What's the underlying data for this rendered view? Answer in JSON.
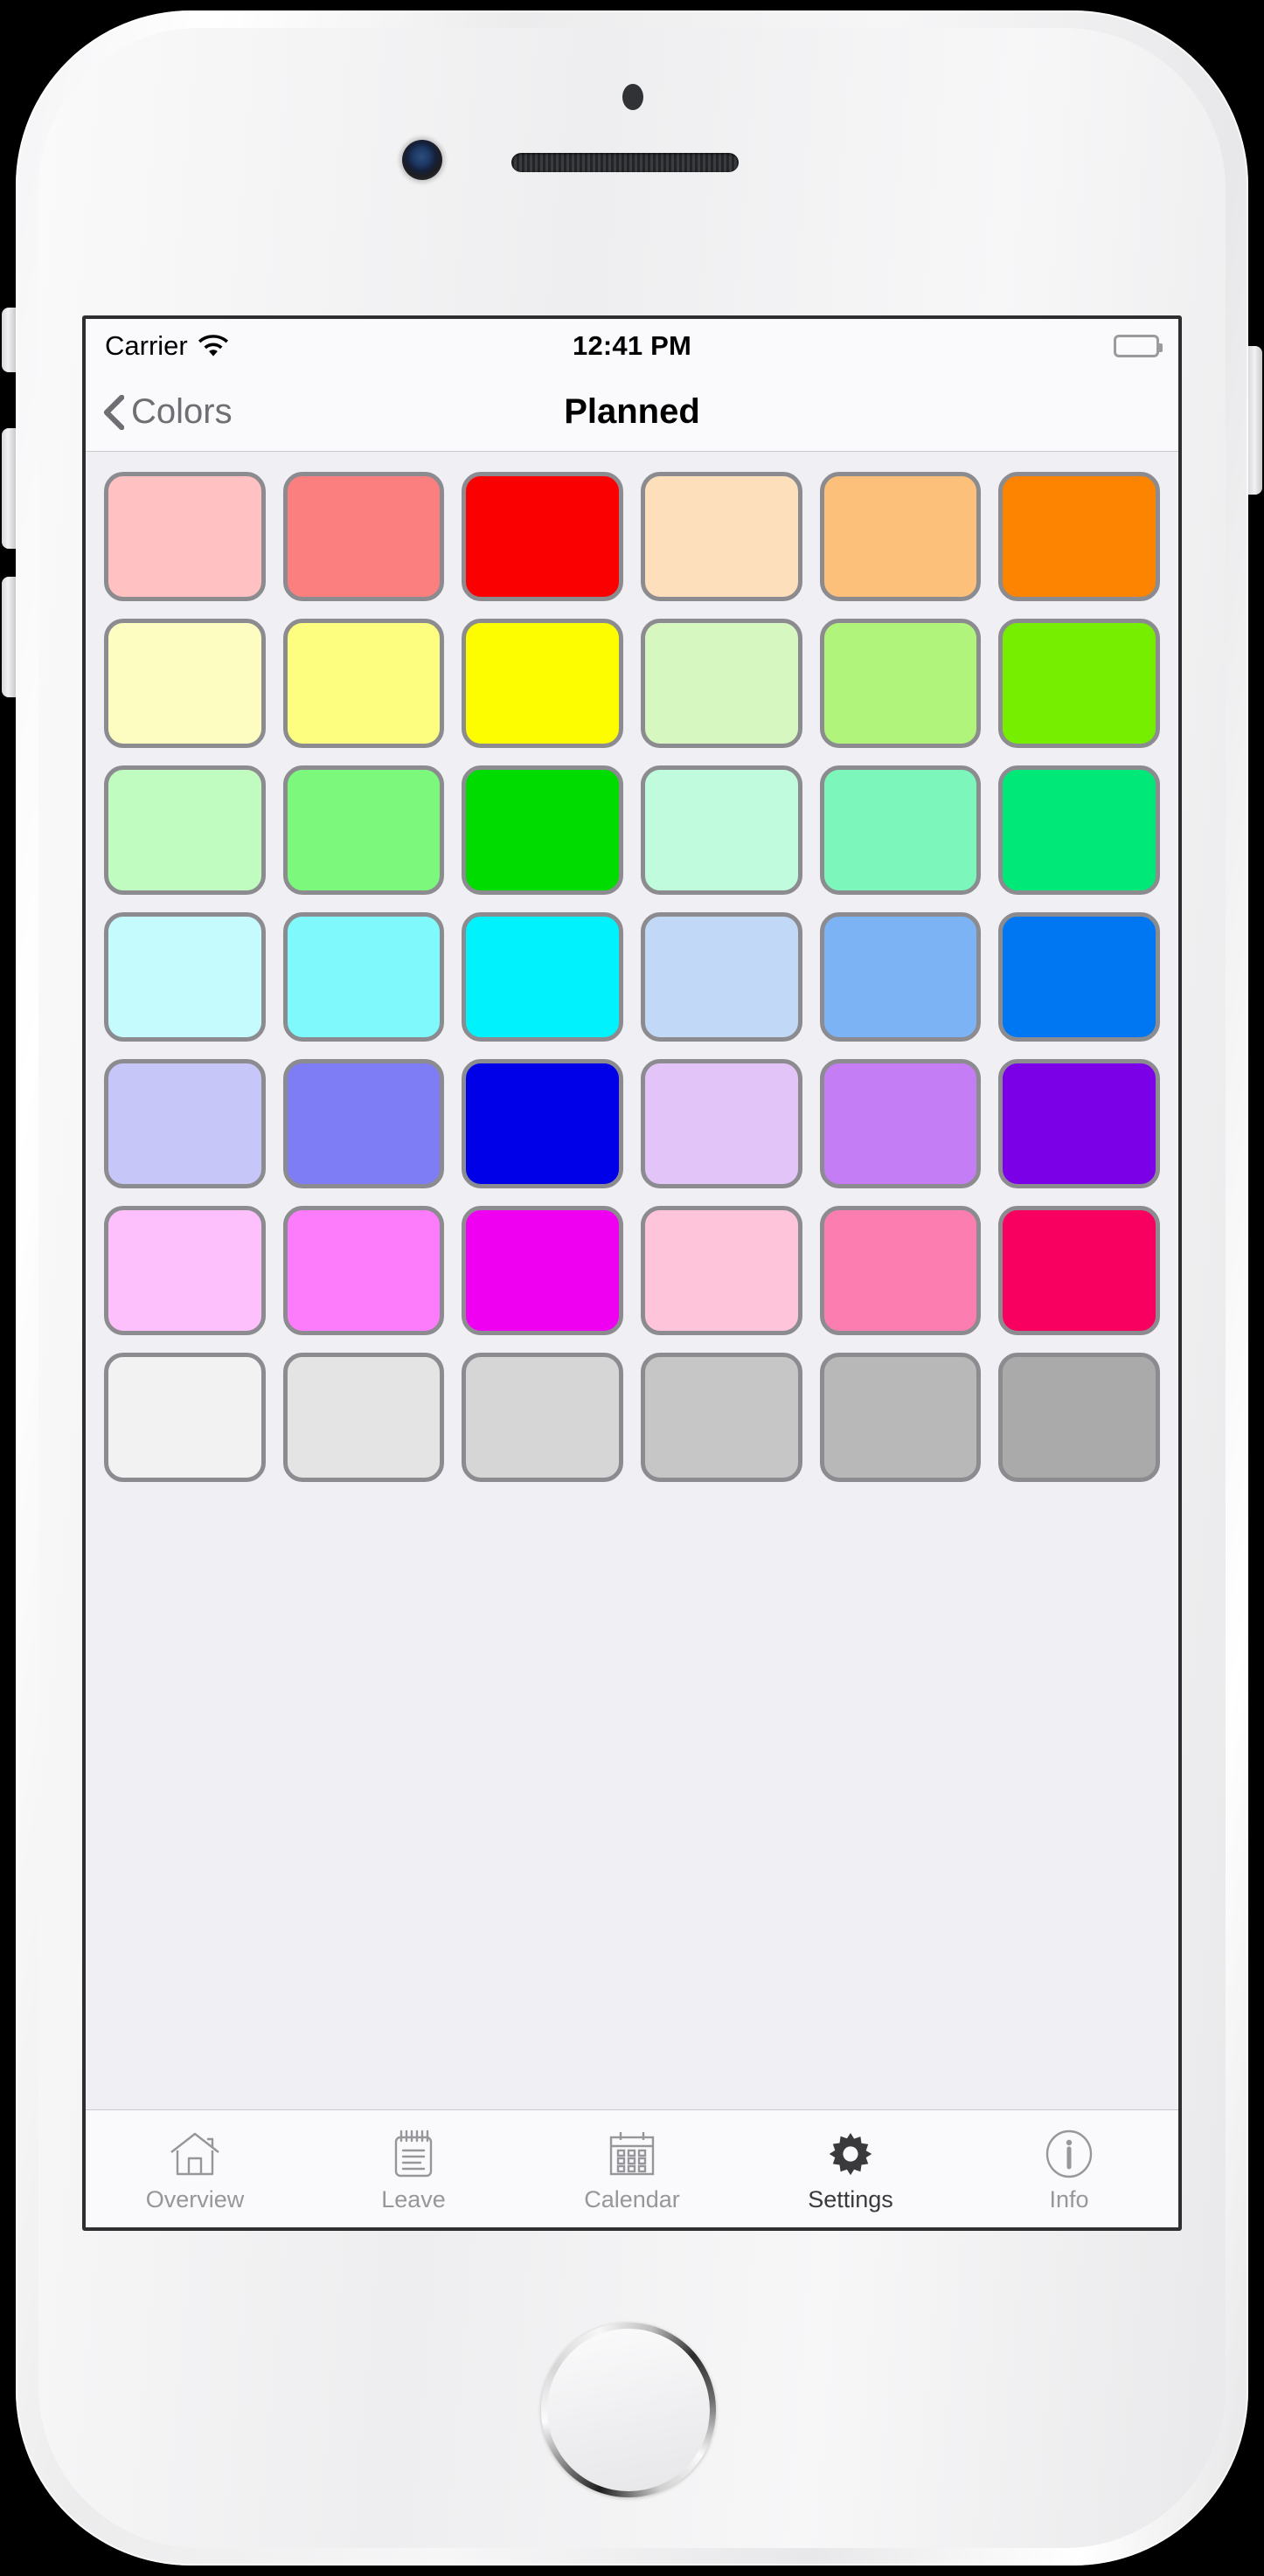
{
  "status_bar": {
    "carrier": "Carrier",
    "wifi_icon": "wifi-icon",
    "time": "12:41 PM",
    "battery_icon": "battery-full-icon"
  },
  "nav_bar": {
    "back_icon": "chevron-left-icon",
    "back_label": "Colors",
    "title": "Planned"
  },
  "color_grid": {
    "columns": 6,
    "rows": 7,
    "border_color": "#8c8c90",
    "background": "#f0f0f4",
    "swatches": [
      {
        "name": "light-pink",
        "hex": "#FFC1C1"
      },
      {
        "name": "salmon",
        "hex": "#FC7F7F"
      },
      {
        "name": "red",
        "hex": "#FB0000"
      },
      {
        "name": "peach",
        "hex": "#FDDFBB"
      },
      {
        "name": "light-orange",
        "hex": "#FCC07A"
      },
      {
        "name": "orange",
        "hex": "#FC8400"
      },
      {
        "name": "pale-yellow",
        "hex": "#FDFDC1"
      },
      {
        "name": "light-yellow",
        "hex": "#FDFD7F"
      },
      {
        "name": "yellow",
        "hex": "#FDFD00"
      },
      {
        "name": "pale-yellow-green",
        "hex": "#D7F7C0"
      },
      {
        "name": "light-yellow-green",
        "hex": "#B0F47C"
      },
      {
        "name": "chartreuse",
        "hex": "#76EE00"
      },
      {
        "name": "pale-green",
        "hex": "#C0FBC0"
      },
      {
        "name": "light-green",
        "hex": "#7CF97C"
      },
      {
        "name": "green",
        "hex": "#00DC00"
      },
      {
        "name": "pale-mint",
        "hex": "#C0FBDE"
      },
      {
        "name": "mint",
        "hex": "#7CF6BB"
      },
      {
        "name": "spring-green",
        "hex": "#00E878"
      },
      {
        "name": "pale-cyan",
        "hex": "#C6FBFD"
      },
      {
        "name": "light-cyan",
        "hex": "#80F9FD"
      },
      {
        "name": "cyan",
        "hex": "#00F2FD"
      },
      {
        "name": "pale-blue",
        "hex": "#C1D9F6"
      },
      {
        "name": "cornflower-blue",
        "hex": "#7CB3F5"
      },
      {
        "name": "blue",
        "hex": "#0077F2"
      },
      {
        "name": "lavender",
        "hex": "#C7C6F8"
      },
      {
        "name": "periwinkle",
        "hex": "#7F7DF5"
      },
      {
        "name": "pure-blue",
        "hex": "#0000E8"
      },
      {
        "name": "pale-violet",
        "hex": "#E3C4F8"
      },
      {
        "name": "medium-violet",
        "hex": "#C57DF5"
      },
      {
        "name": "violet",
        "hex": "#7B00E8"
      },
      {
        "name": "pale-magenta",
        "hex": "#FDC0FC"
      },
      {
        "name": "light-magenta",
        "hex": "#FC7CFB"
      },
      {
        "name": "magenta",
        "hex": "#F000F0"
      },
      {
        "name": "light-pink-2",
        "hex": "#FDC4DA"
      },
      {
        "name": "hot-pink",
        "hex": "#FC7EB0"
      },
      {
        "name": "deep-pink",
        "hex": "#F80060"
      },
      {
        "name": "near-white",
        "hex": "#F2F2F2"
      },
      {
        "name": "gray-92",
        "hex": "#E4E4E4"
      },
      {
        "name": "gray-84",
        "hex": "#D6D6D6"
      },
      {
        "name": "gray-77",
        "hex": "#C6C6C6"
      },
      {
        "name": "gray-70",
        "hex": "#B8B8B8"
      },
      {
        "name": "gray-64",
        "hex": "#AAAAAA"
      }
    ]
  },
  "tab_bar": {
    "selected_index": 3,
    "items": [
      {
        "label": "Overview",
        "icon": "house-icon"
      },
      {
        "label": "Leave",
        "icon": "notepad-icon"
      },
      {
        "label": "Calendar",
        "icon": "calendar-icon"
      },
      {
        "label": "Settings",
        "icon": "gear-icon"
      },
      {
        "label": "Info",
        "icon": "info-circle-icon"
      }
    ]
  }
}
